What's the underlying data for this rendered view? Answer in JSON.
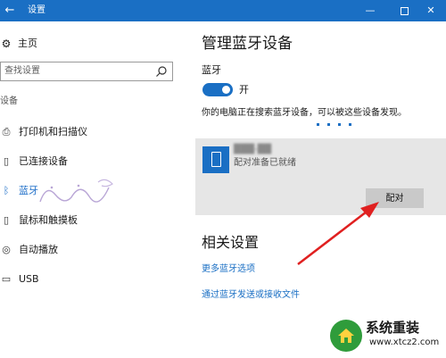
{
  "window": {
    "back_glyph": "←",
    "title": "设置",
    "minimize_glyph": "—",
    "close_glyph": "✕"
  },
  "sidebar": {
    "home_label": "主页",
    "search_placeholder": "查找设置",
    "section_label": "设备",
    "items": [
      {
        "label": "打印机和扫描仪",
        "icon": "printer-icon",
        "glyph": "⎙"
      },
      {
        "label": "已连接设备",
        "icon": "connected-devices-icon",
        "glyph": "▯"
      },
      {
        "label": "蓝牙",
        "icon": "bluetooth-icon",
        "glyph": "ᛒ",
        "active": true
      },
      {
        "label": "鼠标和触摸板",
        "icon": "mouse-icon",
        "glyph": "▯"
      },
      {
        "label": "自动播放",
        "icon": "autoplay-icon",
        "glyph": "◎"
      },
      {
        "label": "USB",
        "icon": "usb-icon",
        "glyph": "▭"
      }
    ]
  },
  "main": {
    "title": "管理蓝牙设备",
    "bluetooth_label": "蓝牙",
    "toggle_state": "开",
    "toggle_on": true,
    "status_text": "你的电脑正在搜索蓝牙设备，可以被这些设备发现。",
    "device": {
      "name": "███-██",
      "status": "配对准备已就绪",
      "pair_label": "配对"
    },
    "related_title": "相关设置",
    "links": [
      "更多蓝牙选项",
      "通过蓝牙发送或接收文件"
    ]
  },
  "watermark_logo": {
    "title": "系统重装",
    "url": "www.xtcz2.com"
  },
  "colors": {
    "accent": "#1a6fc4",
    "titlebar": "#1a6fc4",
    "card_bg": "#e6e6e6",
    "button_bg": "#c9c9c9",
    "annotation_arrow": "#e02020",
    "logo_green": "#2f9c3b"
  }
}
